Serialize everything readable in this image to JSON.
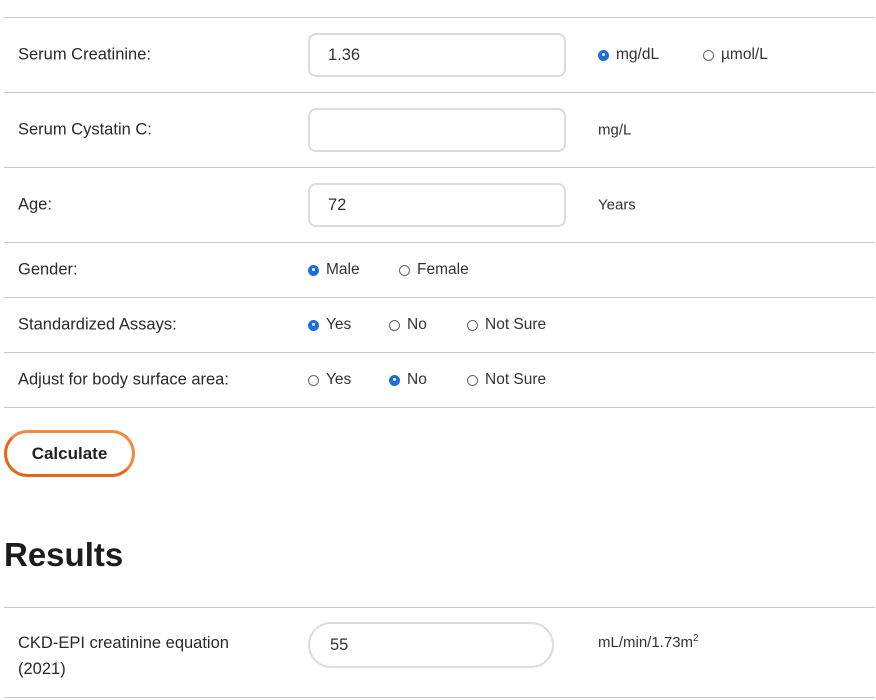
{
  "form": {
    "creatinine": {
      "label": "Serum Creatinine:",
      "value": "1.36",
      "units": [
        {
          "label": "mg/dL",
          "selected": true
        },
        {
          "label": "µmol/L",
          "selected": false
        }
      ]
    },
    "cystatin": {
      "label": "Serum Cystatin C:",
      "value": "",
      "unit": "mg/L"
    },
    "age": {
      "label": "Age:",
      "value": "72",
      "unit": "Years"
    },
    "gender": {
      "label": "Gender:",
      "options": [
        {
          "label": "Male",
          "selected": true
        },
        {
          "label": "Female",
          "selected": false
        }
      ]
    },
    "standardized": {
      "label": "Standardized Assays:",
      "options": [
        {
          "label": "Yes",
          "selected": true
        },
        {
          "label": "No",
          "selected": false
        },
        {
          "label": "Not Sure",
          "selected": false
        }
      ]
    },
    "bsa": {
      "label": "Adjust for body surface area:",
      "options": [
        {
          "label": "Yes",
          "selected": false
        },
        {
          "label": "No",
          "selected": true
        },
        {
          "label": "Not Sure",
          "selected": false
        }
      ]
    }
  },
  "calculate_label": "Calculate",
  "results": {
    "title": "Results",
    "ckd_epi": {
      "label": "CKD-EPI creatinine equation (2021)",
      "value": "55",
      "unit": "mL/min/1.73m",
      "unit_sup": "2"
    }
  },
  "colors": {
    "accent": "#f08a3e",
    "radio_selected": "#1a6fe0",
    "border": "#c8c8c8"
  }
}
